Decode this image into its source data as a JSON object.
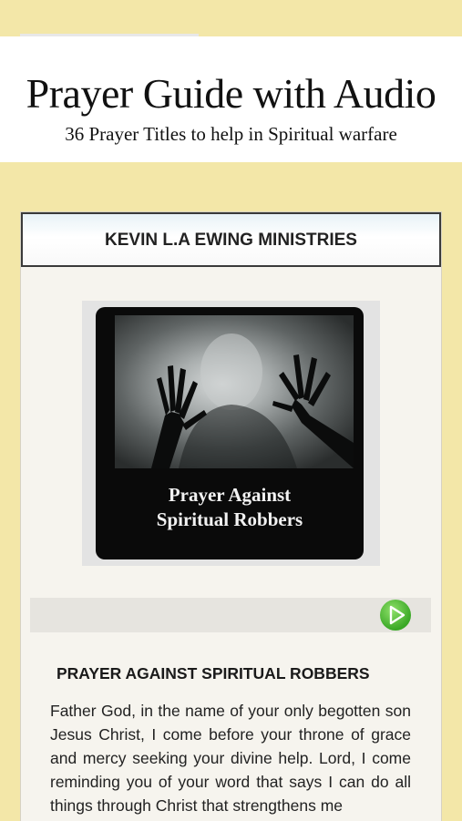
{
  "banner": {
    "title": "Prayer Guide with Audio",
    "subtitle": "36 Prayer Titles to help in Spiritual warfare"
  },
  "card": {
    "header": "KEVIN L.A EWING MINISTRIES",
    "cover": {
      "line1": "Prayer Against",
      "line2": "Spiritual Robbers"
    },
    "player": {
      "play_icon": "play-icon",
      "accent": "#4caf2e"
    },
    "section_title": "PRAYER AGAINST SPIRITUAL ROBBERS",
    "body": "Father God, in the name of your only begotten son Jesus Christ, I come before your throne of grace and mercy seeking your divine help. Lord, I come reminding you of your word that says I can do all things through Christ that strengthens me"
  },
  "colors": {
    "background": "#f3e7a8",
    "card": "#f6f4ee"
  }
}
